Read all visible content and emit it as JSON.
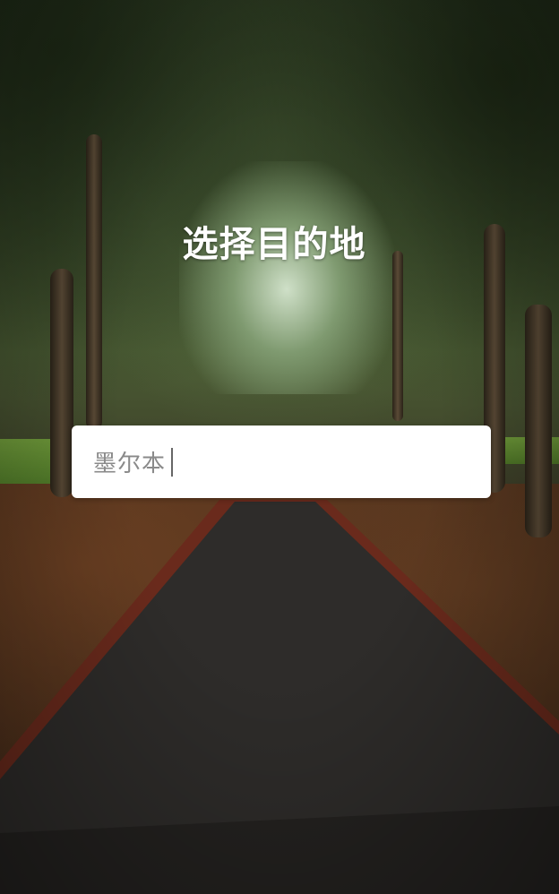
{
  "screen": {
    "title": "选择目的地"
  },
  "search": {
    "value": "墨尔本"
  },
  "colors": {
    "title_text": "#ffffff",
    "input_background": "#ffffff",
    "input_text": "#8a8a8a"
  }
}
